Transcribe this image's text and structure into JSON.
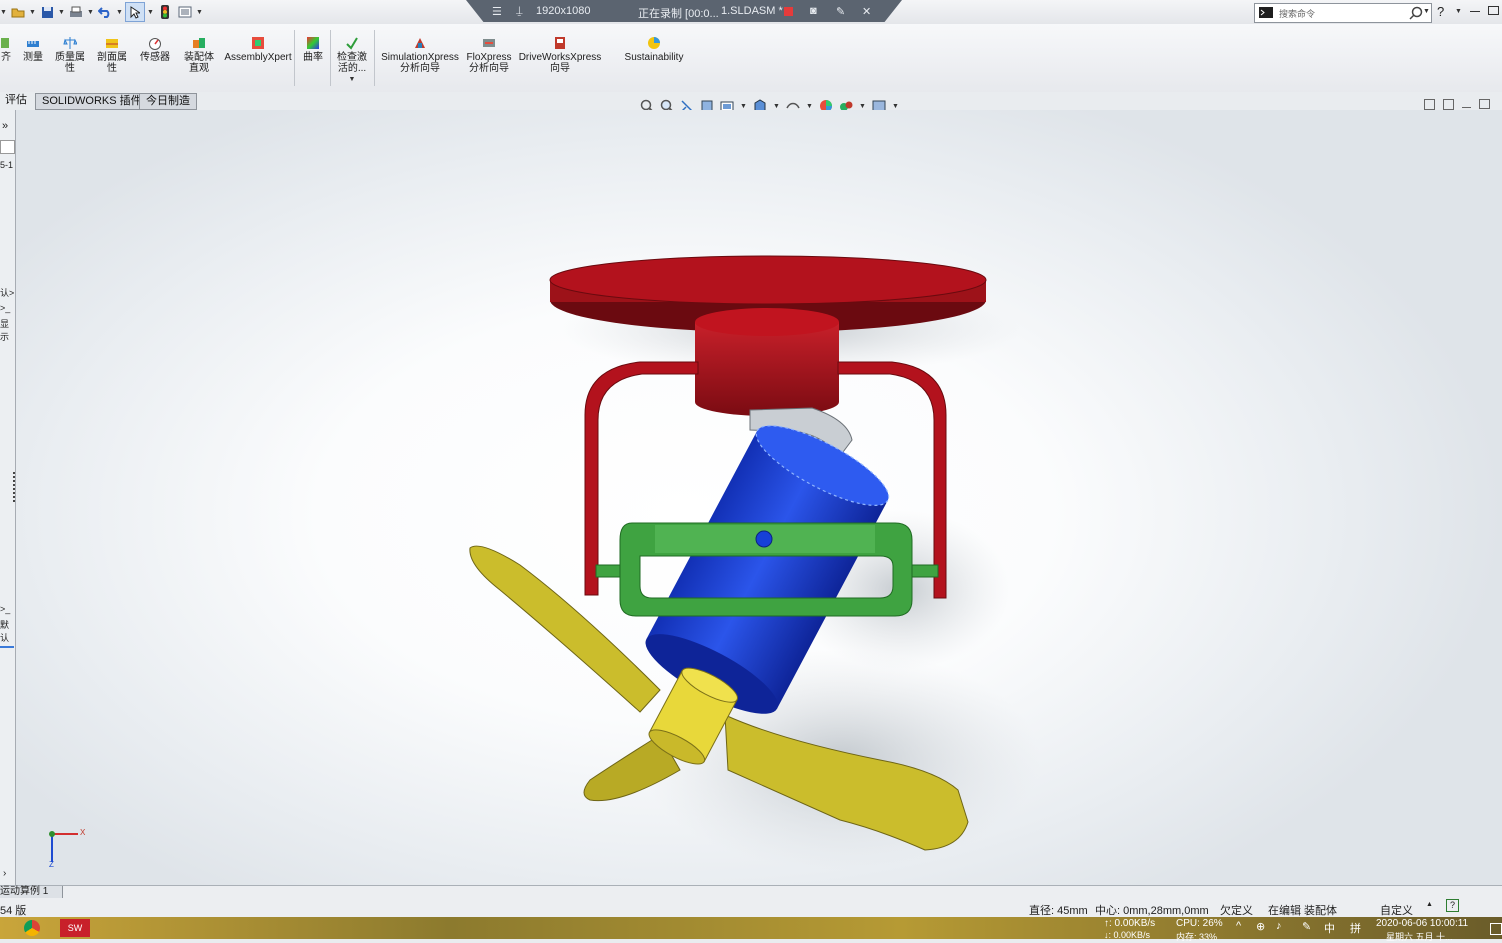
{
  "recording_bar": {
    "resolution": "1920x1080",
    "status": "正在录制 [00:0...",
    "filename": "1.SLDASM *"
  },
  "search": {
    "placeholder": "搜索命令"
  },
  "ribbon": {
    "items": [
      {
        "label": "齐"
      },
      {
        "label": "测量"
      },
      {
        "label": "质量属性"
      },
      {
        "label": "剖面属性"
      },
      {
        "label": "传感器"
      },
      {
        "label": "装配体直观"
      },
      {
        "label": "AssemblyXpert"
      },
      {
        "label": "曲率"
      },
      {
        "label": "检查激活的..."
      },
      {
        "label": "SimulationXpress 分析向导"
      },
      {
        "label": "FloXpress 分析向导"
      },
      {
        "label": "DriveWorksXpress 向导"
      },
      {
        "label": "Sustainability"
      }
    ]
  },
  "tabs": [
    {
      "label": "评估"
    },
    {
      "label": "SOLIDWORKS 插件"
    },
    {
      "label": "今日制造"
    }
  ],
  "left_panel": {
    "texts": [
      "»",
      "5-1",
      "认>",
      ">_",
      "显示",
      ">_",
      "默认"
    ]
  },
  "triad": {
    "x_label": "X",
    "z_label": "Z"
  },
  "motion_tab": {
    "label": "运动算例 1"
  },
  "status_bar": {
    "left": "54 版",
    "diameter": "直径: 45mm",
    "center": "中心: 0mm,28mm,0mm",
    "constraint": "欠定义",
    "editing": "在编辑 装配体",
    "custom": "自定义"
  },
  "taskbar": {
    "net_up": "↑: 0.00KB/s",
    "net_down": "↓: 0.00KB/s",
    "cpu": "CPU: 26%",
    "mem": "内存: 33%",
    "ime_cn": "中",
    "ime_mode": "拼",
    "datetime": "2020-06-06 10:00:11",
    "weekday": "星期六 五月 十..."
  },
  "colors": {
    "red_part": "#b3121d",
    "blue_motor": "#1d3fd6",
    "green_bracket": "#3fa341",
    "yellow_blade": "#cbbd2c"
  }
}
